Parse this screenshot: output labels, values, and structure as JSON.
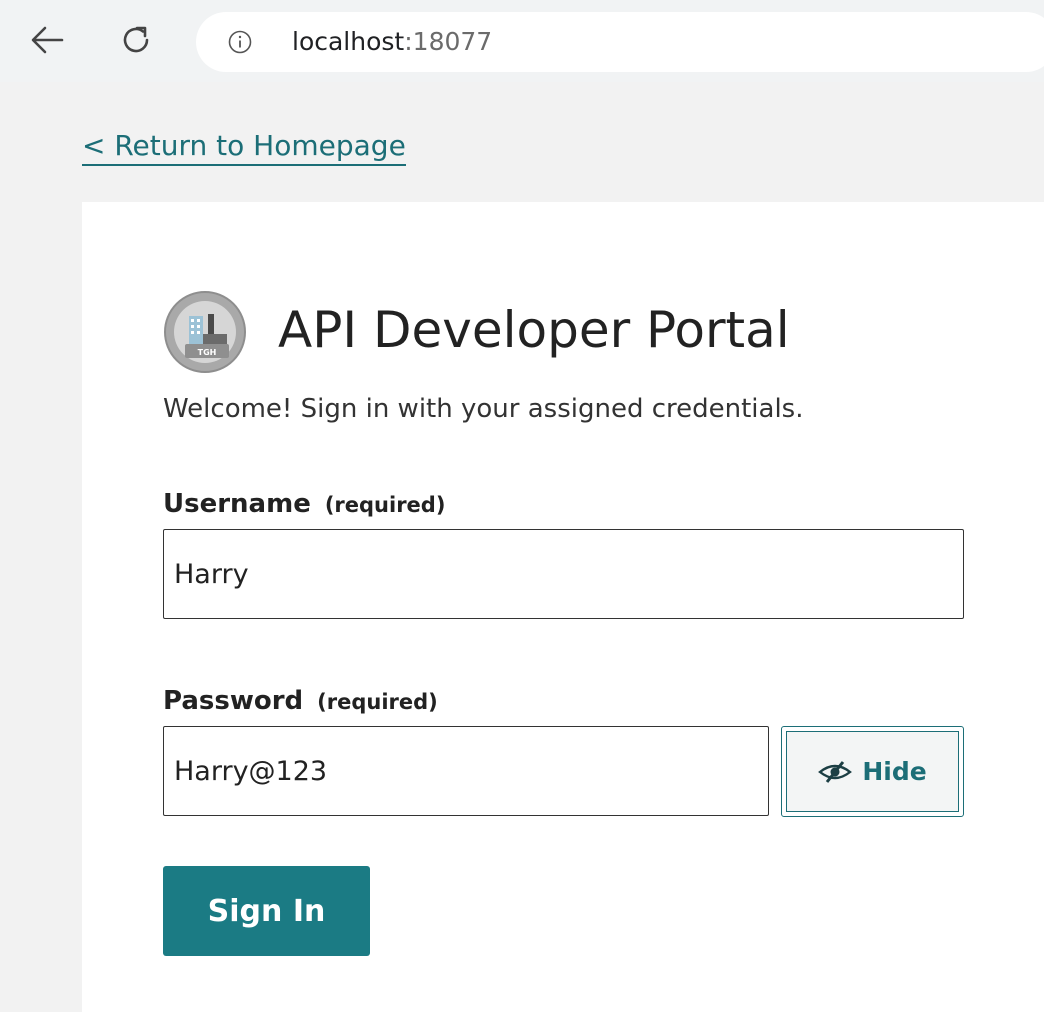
{
  "browser": {
    "url_host": "localhost",
    "url_port": ":18077"
  },
  "page": {
    "return_link": "< Return to Homepage",
    "title": "API Developer Portal",
    "welcome": "Welcome! Sign in with your assigned credentials.",
    "logo_text": "TGH",
    "accent_color": "#1b7b84"
  },
  "form": {
    "username_label": "Username",
    "username_required": "(required)",
    "username_value": "Harry",
    "password_label": "Password",
    "password_required": "(required)",
    "password_value": "Harry@123",
    "hide_label": "Hide",
    "signin_label": "Sign In"
  },
  "icons": {
    "back": "back-arrow-icon",
    "reload": "reload-icon",
    "info": "info-icon",
    "eye_slash": "eye-slash-icon"
  }
}
